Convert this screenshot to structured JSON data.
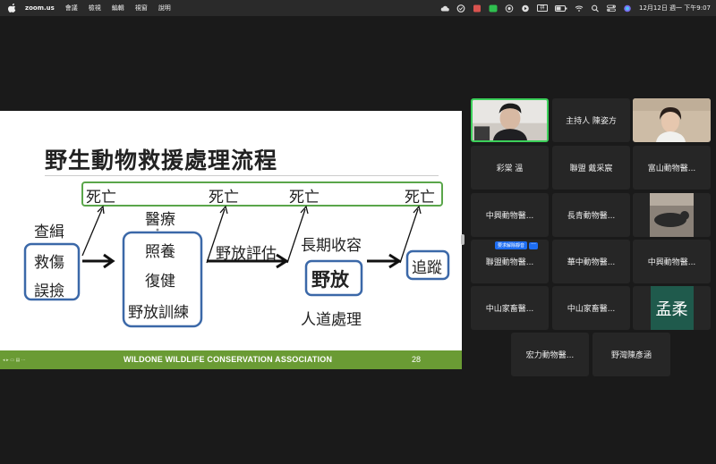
{
  "menubar": {
    "app_name": "zoom.us",
    "items": [
      "會議",
      "檢視",
      "編輯",
      "視窗",
      "說明"
    ],
    "datetime": "12月12日 週一 下午9:07",
    "input_indicator": "拼"
  },
  "slide": {
    "title": "野生動物救援處理流程",
    "death_labels": [
      "死亡",
      "死亡",
      "死亡",
      "死亡"
    ],
    "left_stack": [
      "查緝",
      "救傷",
      "誤撿"
    ],
    "center_stack_top": "醫療",
    "center_stack": [
      "照養",
      "復健",
      "野放訓練"
    ],
    "evaluate": "野放評估",
    "long_term": "長期收容",
    "release": "野放",
    "euthanasia": "人道處理",
    "tracking": "追蹤",
    "footer_org": "WILDONE WILDLIFE CONSERVATION ASSOCIATION",
    "page_number": "28",
    "accent_green": "#6a9b34",
    "box_blue": "#3b68a8",
    "box_green": "#5aa64a"
  },
  "participants": {
    "host": "主持人 陳姿方",
    "names": [
      "彩棠 溫",
      "聯盟 戴采宸",
      "富山動物醫...",
      "中興動物醫...",
      "長青動物醫...",
      "聯盟動物醫...",
      "華中動物醫...",
      "中興動物醫...",
      "中山家畜醫...",
      "中山家畜醫...",
      "宏力動物醫...",
      "野灣陳彥涵"
    ],
    "avatar_text": "孟柔",
    "unmute_badge": "要求解除靜音",
    "more_badge": "···",
    "active_speaker_color": "#3cd05a"
  }
}
